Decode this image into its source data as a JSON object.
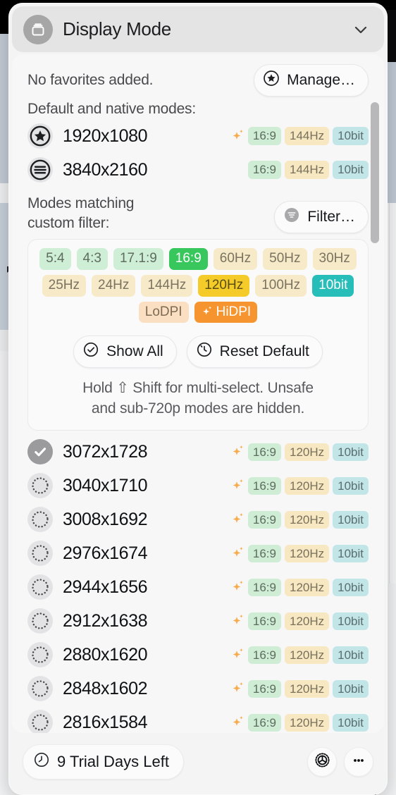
{
  "header": {
    "title": "Display Mode",
    "icon": "display-icon",
    "chevron": "chevron-down-icon"
  },
  "favorites": {
    "empty_text": "No favorites added.",
    "manage_label": "Manage…",
    "manage_icon": "star-icon"
  },
  "default_section": {
    "label": "Default and native modes:",
    "modes": [
      {
        "name": "1920x1080",
        "mark": "star-icon",
        "hidpi": true,
        "ratio": "16:9",
        "hz": "144Hz",
        "bit": "10bit"
      },
      {
        "name": "3840x2160",
        "mark": "lines-icon",
        "hidpi": false,
        "ratio": "16:9",
        "hz": "144Hz",
        "bit": "10bit"
      }
    ]
  },
  "filter_section": {
    "label_line1": "Modes matching",
    "label_line2": "custom filter:",
    "filter_label": "Filter…",
    "filter_icon": "filter-icon",
    "chip_rows": [
      [
        {
          "label": "5:4",
          "kind": "ratio",
          "active": false
        },
        {
          "label": "4:3",
          "kind": "ratio",
          "active": false
        },
        {
          "label": "17.1:9",
          "kind": "ratio",
          "active": false
        },
        {
          "label": "16:9",
          "kind": "ratio",
          "active": true
        },
        {
          "label": "60Hz",
          "kind": "hz",
          "active": false
        },
        {
          "label": "50Hz",
          "kind": "hz",
          "active": false
        },
        {
          "label": "30Hz",
          "kind": "hz",
          "active": false
        }
      ],
      [
        {
          "label": "25Hz",
          "kind": "hz",
          "active": false
        },
        {
          "label": "24Hz",
          "kind": "hz",
          "active": false
        },
        {
          "label": "144Hz",
          "kind": "hz",
          "active": false
        },
        {
          "label": "120Hz",
          "kind": "hz",
          "active": true
        },
        {
          "label": "100Hz",
          "kind": "hz",
          "active": false
        },
        {
          "label": "10bit",
          "kind": "bit",
          "active": true
        }
      ],
      [
        {
          "label": "LoDPI",
          "kind": "lodpi",
          "active": false
        },
        {
          "label": "HiDPI",
          "kind": "hidpi",
          "active": true,
          "icon": "sparkle-icon"
        }
      ]
    ],
    "show_all_label": "Show All",
    "show_all_icon": "check-circle-icon",
    "reset_label": "Reset Default",
    "reset_icon": "reset-clock-icon",
    "hint_line1": "Hold ⇧ Shift for multi-select. Unsafe",
    "hint_line2": "and sub-720p modes are hidden."
  },
  "results": [
    {
      "name": "3072x1728",
      "selected": true,
      "hidpi": true,
      "ratio": "16:9",
      "hz": "120Hz",
      "bit": "10bit"
    },
    {
      "name": "3040x1710",
      "selected": false,
      "hidpi": true,
      "ratio": "16:9",
      "hz": "120Hz",
      "bit": "10bit"
    },
    {
      "name": "3008x1692",
      "selected": false,
      "hidpi": true,
      "ratio": "16:9",
      "hz": "120Hz",
      "bit": "10bit"
    },
    {
      "name": "2976x1674",
      "selected": false,
      "hidpi": true,
      "ratio": "16:9",
      "hz": "120Hz",
      "bit": "10bit"
    },
    {
      "name": "2944x1656",
      "selected": false,
      "hidpi": true,
      "ratio": "16:9",
      "hz": "120Hz",
      "bit": "10bit"
    },
    {
      "name": "2912x1638",
      "selected": false,
      "hidpi": true,
      "ratio": "16:9",
      "hz": "120Hz",
      "bit": "10bit"
    },
    {
      "name": "2880x1620",
      "selected": false,
      "hidpi": true,
      "ratio": "16:9",
      "hz": "120Hz",
      "bit": "10bit"
    },
    {
      "name": "2848x1602",
      "selected": false,
      "hidpi": true,
      "ratio": "16:9",
      "hz": "120Hz",
      "bit": "10bit"
    },
    {
      "name": "2816x1584",
      "selected": false,
      "hidpi": true,
      "ratio": "16:9",
      "hz": "120Hz",
      "bit": "10bit"
    }
  ],
  "footer": {
    "trial_label": "9 Trial Days Left",
    "trial_icon": "clock-icon",
    "settings_icon": "gear-icon",
    "more_icon": "ellipsis-icon"
  },
  "colors": {
    "panel_bg": "#f4f4f5",
    "header_bg": "#e4e4e5",
    "ratio_tag": "#cfedd5",
    "hz_tag": "#f8e8c2",
    "bit_tag": "#c2e6e7",
    "ratio_active": "#37c75c",
    "hz_active": "#f5cb2a",
    "bit_active": "#27bdb9",
    "hidpi_active": "#f69530",
    "lodpi": "#fadfc2",
    "sparkle": "#f8ab4c"
  }
}
